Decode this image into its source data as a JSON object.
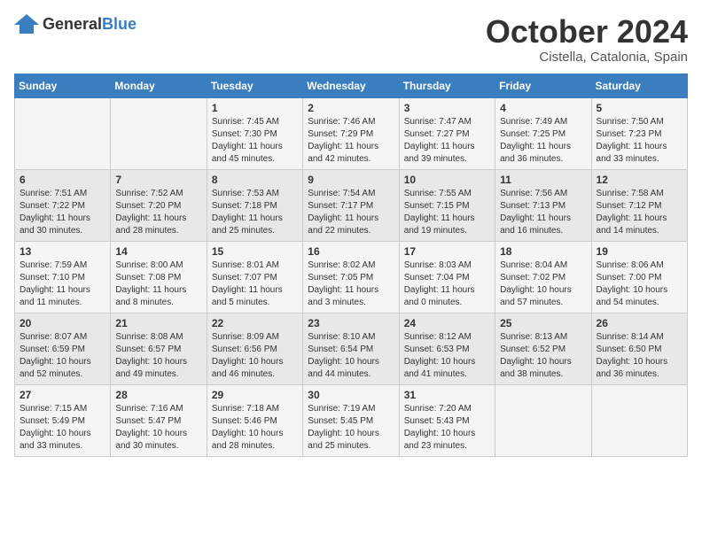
{
  "header": {
    "logo": {
      "general": "General",
      "blue": "Blue"
    },
    "month": "October 2024",
    "location": "Cistella, Catalonia, Spain"
  },
  "weekdays": [
    "Sunday",
    "Monday",
    "Tuesday",
    "Wednesday",
    "Thursday",
    "Friday",
    "Saturday"
  ],
  "weeks": [
    [
      {
        "day": "",
        "sunrise": "",
        "sunset": "",
        "daylight": ""
      },
      {
        "day": "",
        "sunrise": "",
        "sunset": "",
        "daylight": ""
      },
      {
        "day": "1",
        "sunrise": "Sunrise: 7:45 AM",
        "sunset": "Sunset: 7:30 PM",
        "daylight": "Daylight: 11 hours and 45 minutes."
      },
      {
        "day": "2",
        "sunrise": "Sunrise: 7:46 AM",
        "sunset": "Sunset: 7:29 PM",
        "daylight": "Daylight: 11 hours and 42 minutes."
      },
      {
        "day": "3",
        "sunrise": "Sunrise: 7:47 AM",
        "sunset": "Sunset: 7:27 PM",
        "daylight": "Daylight: 11 hours and 39 minutes."
      },
      {
        "day": "4",
        "sunrise": "Sunrise: 7:49 AM",
        "sunset": "Sunset: 7:25 PM",
        "daylight": "Daylight: 11 hours and 36 minutes."
      },
      {
        "day": "5",
        "sunrise": "Sunrise: 7:50 AM",
        "sunset": "Sunset: 7:23 PM",
        "daylight": "Daylight: 11 hours and 33 minutes."
      }
    ],
    [
      {
        "day": "6",
        "sunrise": "Sunrise: 7:51 AM",
        "sunset": "Sunset: 7:22 PM",
        "daylight": "Daylight: 11 hours and 30 minutes."
      },
      {
        "day": "7",
        "sunrise": "Sunrise: 7:52 AM",
        "sunset": "Sunset: 7:20 PM",
        "daylight": "Daylight: 11 hours and 28 minutes."
      },
      {
        "day": "8",
        "sunrise": "Sunrise: 7:53 AM",
        "sunset": "Sunset: 7:18 PM",
        "daylight": "Daylight: 11 hours and 25 minutes."
      },
      {
        "day": "9",
        "sunrise": "Sunrise: 7:54 AM",
        "sunset": "Sunset: 7:17 PM",
        "daylight": "Daylight: 11 hours and 22 minutes."
      },
      {
        "day": "10",
        "sunrise": "Sunrise: 7:55 AM",
        "sunset": "Sunset: 7:15 PM",
        "daylight": "Daylight: 11 hours and 19 minutes."
      },
      {
        "day": "11",
        "sunrise": "Sunrise: 7:56 AM",
        "sunset": "Sunset: 7:13 PM",
        "daylight": "Daylight: 11 hours and 16 minutes."
      },
      {
        "day": "12",
        "sunrise": "Sunrise: 7:58 AM",
        "sunset": "Sunset: 7:12 PM",
        "daylight": "Daylight: 11 hours and 14 minutes."
      }
    ],
    [
      {
        "day": "13",
        "sunrise": "Sunrise: 7:59 AM",
        "sunset": "Sunset: 7:10 PM",
        "daylight": "Daylight: 11 hours and 11 minutes."
      },
      {
        "day": "14",
        "sunrise": "Sunrise: 8:00 AM",
        "sunset": "Sunset: 7:08 PM",
        "daylight": "Daylight: 11 hours and 8 minutes."
      },
      {
        "day": "15",
        "sunrise": "Sunrise: 8:01 AM",
        "sunset": "Sunset: 7:07 PM",
        "daylight": "Daylight: 11 hours and 5 minutes."
      },
      {
        "day": "16",
        "sunrise": "Sunrise: 8:02 AM",
        "sunset": "Sunset: 7:05 PM",
        "daylight": "Daylight: 11 hours and 3 minutes."
      },
      {
        "day": "17",
        "sunrise": "Sunrise: 8:03 AM",
        "sunset": "Sunset: 7:04 PM",
        "daylight": "Daylight: 11 hours and 0 minutes."
      },
      {
        "day": "18",
        "sunrise": "Sunrise: 8:04 AM",
        "sunset": "Sunset: 7:02 PM",
        "daylight": "Daylight: 10 hours and 57 minutes."
      },
      {
        "day": "19",
        "sunrise": "Sunrise: 8:06 AM",
        "sunset": "Sunset: 7:00 PM",
        "daylight": "Daylight: 10 hours and 54 minutes."
      }
    ],
    [
      {
        "day": "20",
        "sunrise": "Sunrise: 8:07 AM",
        "sunset": "Sunset: 6:59 PM",
        "daylight": "Daylight: 10 hours and 52 minutes."
      },
      {
        "day": "21",
        "sunrise": "Sunrise: 8:08 AM",
        "sunset": "Sunset: 6:57 PM",
        "daylight": "Daylight: 10 hours and 49 minutes."
      },
      {
        "day": "22",
        "sunrise": "Sunrise: 8:09 AM",
        "sunset": "Sunset: 6:56 PM",
        "daylight": "Daylight: 10 hours and 46 minutes."
      },
      {
        "day": "23",
        "sunrise": "Sunrise: 8:10 AM",
        "sunset": "Sunset: 6:54 PM",
        "daylight": "Daylight: 10 hours and 44 minutes."
      },
      {
        "day": "24",
        "sunrise": "Sunrise: 8:12 AM",
        "sunset": "Sunset: 6:53 PM",
        "daylight": "Daylight: 10 hours and 41 minutes."
      },
      {
        "day": "25",
        "sunrise": "Sunrise: 8:13 AM",
        "sunset": "Sunset: 6:52 PM",
        "daylight": "Daylight: 10 hours and 38 minutes."
      },
      {
        "day": "26",
        "sunrise": "Sunrise: 8:14 AM",
        "sunset": "Sunset: 6:50 PM",
        "daylight": "Daylight: 10 hours and 36 minutes."
      }
    ],
    [
      {
        "day": "27",
        "sunrise": "Sunrise: 7:15 AM",
        "sunset": "Sunset: 5:49 PM",
        "daylight": "Daylight: 10 hours and 33 minutes."
      },
      {
        "day": "28",
        "sunrise": "Sunrise: 7:16 AM",
        "sunset": "Sunset: 5:47 PM",
        "daylight": "Daylight: 10 hours and 30 minutes."
      },
      {
        "day": "29",
        "sunrise": "Sunrise: 7:18 AM",
        "sunset": "Sunset: 5:46 PM",
        "daylight": "Daylight: 10 hours and 28 minutes."
      },
      {
        "day": "30",
        "sunrise": "Sunrise: 7:19 AM",
        "sunset": "Sunset: 5:45 PM",
        "daylight": "Daylight: 10 hours and 25 minutes."
      },
      {
        "day": "31",
        "sunrise": "Sunrise: 7:20 AM",
        "sunset": "Sunset: 5:43 PM",
        "daylight": "Daylight: 10 hours and 23 minutes."
      },
      {
        "day": "",
        "sunrise": "",
        "sunset": "",
        "daylight": ""
      },
      {
        "day": "",
        "sunrise": "",
        "sunset": "",
        "daylight": ""
      }
    ]
  ]
}
